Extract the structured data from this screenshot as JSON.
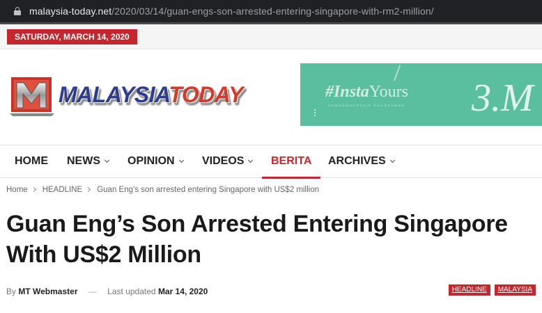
{
  "browser": {
    "url_domain": "malaysia-today.net",
    "url_path": "/2020/03/14/guan-engs-son-arrested-entering-singapore-with-rm2-million/"
  },
  "topbar": {
    "date": "SATURDAY, MARCH 14, 2020",
    "accent_color": "#c4272d"
  },
  "header": {
    "logo_text_1": "MALAYSIA",
    "logo_text_2": "TODAY",
    "logo_icon": "mt-logo-icon",
    "ad": {
      "title_prefix": "#Insta",
      "title_suffix": "Yours",
      "subtitle": "HOMEOWNERSHIP PROGRAMME",
      "big_text": "3.M",
      "bg_color": "#5abf9e"
    }
  },
  "nav": {
    "items": [
      {
        "label": "HOME",
        "dropdown": false
      },
      {
        "label": "NEWS",
        "dropdown": true
      },
      {
        "label": "OPINION",
        "dropdown": true
      },
      {
        "label": "VIDEOS",
        "dropdown": true
      },
      {
        "label": "BERITA",
        "dropdown": false,
        "active": true
      },
      {
        "label": "ARCHIVES",
        "dropdown": true
      }
    ]
  },
  "breadcrumb": {
    "home": "Home",
    "category": "HEADLINE",
    "current": "Guan Eng’s son arrested entering Singapore with US$2 million"
  },
  "article": {
    "title": "Guan Eng’s Son Arrested Entering Singapore With US$2 Million",
    "by_label": "By",
    "author": "MT Webmaster",
    "dash": "—",
    "updated_label": "Last updated",
    "updated_date": "Mar 14, 2020",
    "tags": [
      "HEADLINE",
      "MALAYSIA"
    ]
  }
}
